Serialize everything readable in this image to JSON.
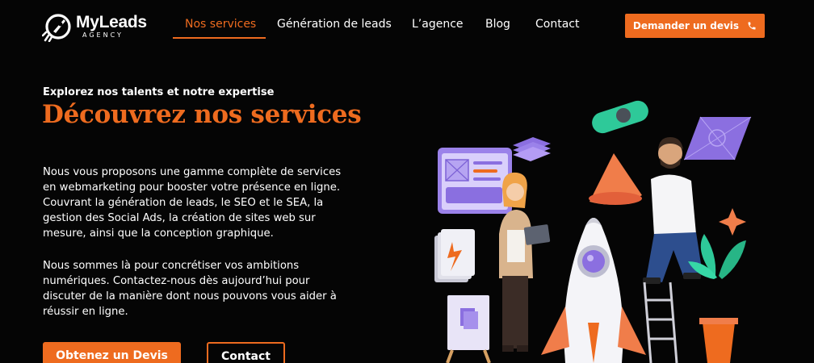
{
  "brand": {
    "name": "MyLeads",
    "tagline": "AGENCY"
  },
  "nav": {
    "items": [
      {
        "label": "Nos services",
        "active": true
      },
      {
        "label": "Génération de leads",
        "active": false
      },
      {
        "label": "L’agence",
        "active": false
      },
      {
        "label": "Blog",
        "active": false
      },
      {
        "label": "Contact",
        "active": false
      }
    ],
    "cta_label": "Demander un devis",
    "cta_icon": "phone-icon"
  },
  "hero": {
    "eyebrow": "Explorez nos talents et notre expertise",
    "title": "Découvrez nos services",
    "paragraph1": "Nous vous proposons une gamme complète de services en webmarketing pour booster votre présence en ligne. Couvrant la génération de leads, le SEO et le SEA, la gestion des Social Ads, la création de sites web sur mesure, ainsi que la conception graphique.",
    "paragraph2": "Nous sommes là pour concrétiser vos ambitions numériques. Contactez-nous dès aujourd’hui pour discuter de la manière dont nous pouvons vous aider à réussir en ligne.",
    "primary_button": "Obtenez un Devis",
    "secondary_button": "Contact"
  },
  "colors": {
    "accent": "#ee6b1f",
    "background": "#050505",
    "purple": "#8b6fe0",
    "mint": "#2ec999"
  }
}
